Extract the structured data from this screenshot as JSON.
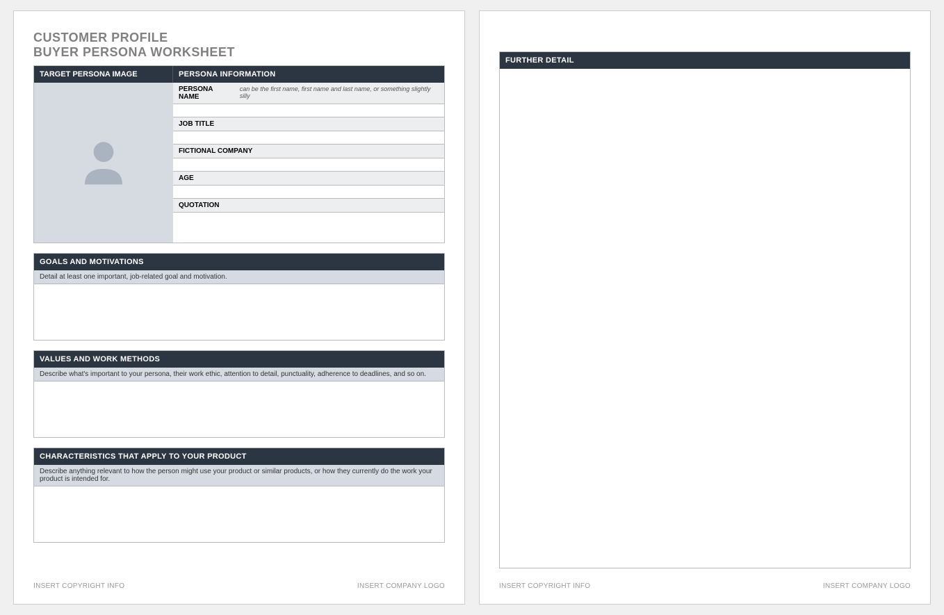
{
  "title": {
    "line1": "CUSTOMER PROFILE",
    "line2": "BUYER PERSONA WORKSHEET"
  },
  "headers": {
    "targetImage": "TARGET PERSONA IMAGE",
    "personaInfo": "PERSONA INFORMATION"
  },
  "fields": {
    "personaName": {
      "label": "PERSONA NAME",
      "hint": "can be the first name, first name and last name, or something slightly silly",
      "value": ""
    },
    "jobTitle": {
      "label": "JOB TITLE",
      "value": ""
    },
    "fictionalCompany": {
      "label": "FICTIONAL COMPANY",
      "value": ""
    },
    "age": {
      "label": "AGE",
      "value": ""
    },
    "quotation": {
      "label": "QUOTATION",
      "value": ""
    }
  },
  "sections": {
    "goals": {
      "title": "GOALS AND MOTIVATIONS",
      "hint": "Detail at least one important, job-related goal and motivation."
    },
    "values": {
      "title": "VALUES AND WORK METHODS",
      "hint": "Describe what's important to your persona, their work ethic, attention to detail, punctuality, adherence to deadlines, and so on."
    },
    "characteristics": {
      "title": "CHARACTERISTICS THAT APPLY TO YOUR PRODUCT",
      "hint": "Describe anything relevant to how the person might use your product or similar products, or how they currently do the work your product is intended for."
    },
    "further": {
      "title": "FURTHER DETAIL"
    }
  },
  "footer": {
    "copyright": "INSERT COPYRIGHT INFO",
    "logo": "INSERT COMPANY LOGO"
  }
}
